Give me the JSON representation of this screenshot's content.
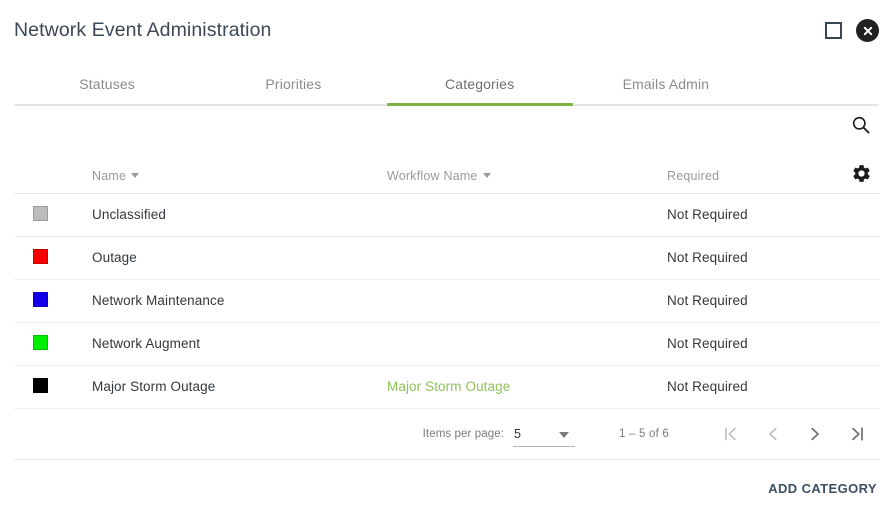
{
  "window": {
    "title": "Network Event Administration",
    "maximize_icon": "square-outline-icon",
    "close_icon": "close-circle-icon"
  },
  "tabs": {
    "items": [
      {
        "label": "Statuses",
        "active": false
      },
      {
        "label": "Priorities",
        "active": false
      },
      {
        "label": "Categories",
        "active": true
      },
      {
        "label": "Emails Admin",
        "active": false
      }
    ],
    "active_index": 2,
    "active_underline_color": "#7cb342"
  },
  "side_actions": [
    {
      "name": "search-icon",
      "label": "Search"
    },
    {
      "name": "gear-icon",
      "label": "Settings"
    }
  ],
  "table": {
    "columns": [
      {
        "key": "swatch",
        "label": ""
      },
      {
        "key": "name",
        "label": "Name",
        "sortable": true
      },
      {
        "key": "workflow_name",
        "label": "Workflow Name",
        "sortable": true
      },
      {
        "key": "required",
        "label": "Required",
        "sortable": false
      }
    ],
    "rows": [
      {
        "color": "#bdbdbd",
        "name": "Unclassified",
        "workflow_name": "",
        "required": "Not Required"
      },
      {
        "color": "#f90000",
        "name": "Outage",
        "workflow_name": "",
        "required": "Not Required"
      },
      {
        "color": "#1400e6",
        "name": "Network Maintenance",
        "workflow_name": "",
        "required": "Not Required"
      },
      {
        "color": "#00ef00",
        "name": "Network Augment",
        "workflow_name": "",
        "required": "Not Required"
      },
      {
        "color": "#000000",
        "name": "Major Storm Outage",
        "workflow_name": "Major Storm Outage",
        "required": "Not Required"
      }
    ],
    "link_color": "#8fc25a"
  },
  "paginator": {
    "items_per_page_label": "Items per page:",
    "items_per_page_value": "5",
    "range_label": "1 – 5 of 6",
    "buttons": [
      {
        "name": "first-page-button",
        "icon": "first-page-icon",
        "disabled": true
      },
      {
        "name": "previous-page-button",
        "icon": "chevron-left-icon",
        "disabled": true
      },
      {
        "name": "next-page-button",
        "icon": "chevron-right-icon",
        "disabled": false
      },
      {
        "name": "last-page-button",
        "icon": "last-page-icon",
        "disabled": false
      }
    ]
  },
  "footer": {
    "add_button_label": "ADD CATEGORY"
  }
}
